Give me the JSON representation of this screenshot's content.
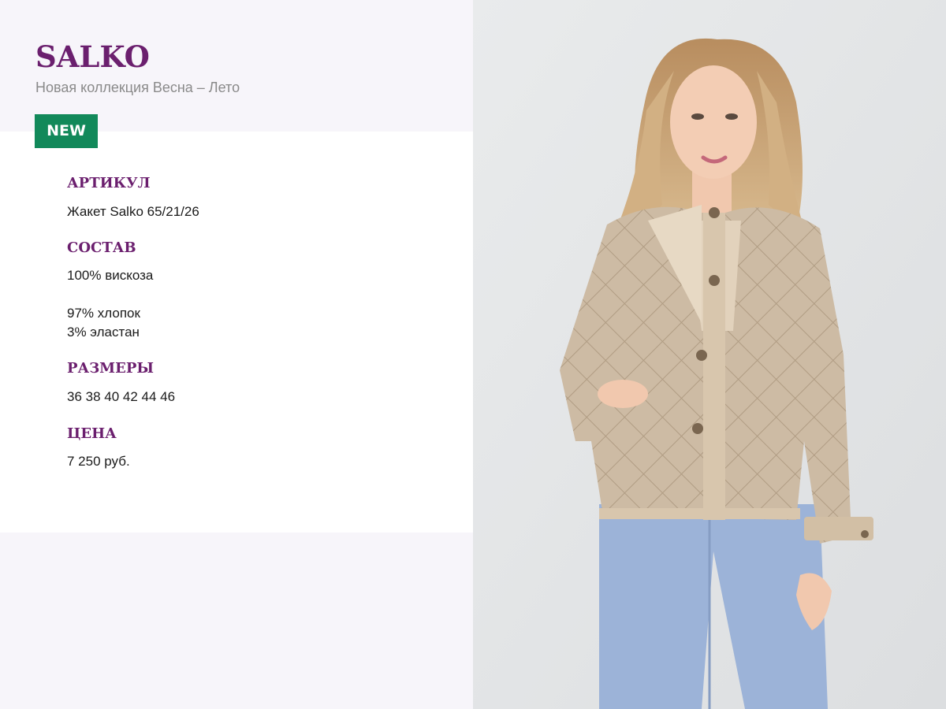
{
  "brand": {
    "name": "SALKO",
    "subtitle": "Новая коллекция Весна – Лето"
  },
  "badge": {
    "label": "NEW",
    "color": "#12895a"
  },
  "colors": {
    "accent": "#6b1f6e",
    "text": "#1a1a1a",
    "muted": "#8a8a8a",
    "background": "#f7f5fa"
  },
  "sections": {
    "article": {
      "title": "АРТИКУЛ",
      "value": "Жакет Salko 65/21/26"
    },
    "composition": {
      "title": "СОСТАВ",
      "lines": [
        "100% вискоза",
        "97% хлопок",
        "3% эластан"
      ]
    },
    "sizes": {
      "title": "РАЗМЕРЫ",
      "value": "36 38 40 42 44 46"
    },
    "price": {
      "title": "ЦЕНА",
      "value": "7 250 руб."
    }
  },
  "photo": {
    "icon": "model-photo"
  }
}
